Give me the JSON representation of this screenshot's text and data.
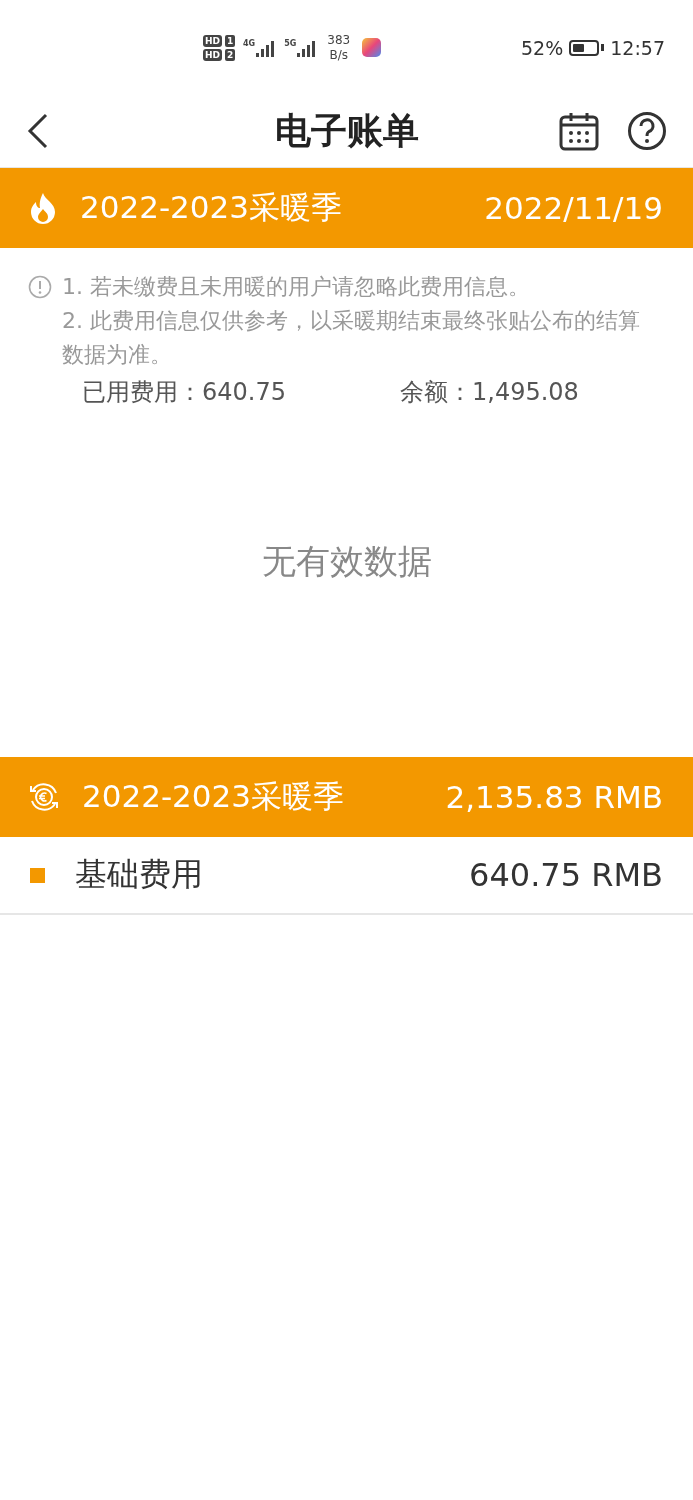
{
  "status_bar": {
    "sims": [
      {
        "hd": "HD",
        "slot": "1",
        "network": "4G"
      },
      {
        "hd": "HD",
        "slot": "2",
        "network": "5G"
      }
    ],
    "speed_value": "383",
    "speed_unit": "B/s",
    "battery": "52%",
    "time": "12:57"
  },
  "header": {
    "title": "电子账单"
  },
  "season_bar": {
    "title": "2022-2023采暖季",
    "date": "2022/11/19"
  },
  "notes": [
    "1. 若未缴费且未用暖的用户请忽略此费用信息。",
    "2. 此费用信息仅供参考，以采暖期结束最终张贴公布的结算数据为准。"
  ],
  "summary": [
    {
      "label": "已用费用：",
      "value": "640.75"
    },
    {
      "label": "余额：",
      "value": "1,495.08"
    }
  ],
  "empty_message": "无有效数据",
  "total_bar": {
    "title": "2022-2023采暖季",
    "amount": "2,135.83 RMB"
  },
  "fees": [
    {
      "name": "基础费用",
      "amount": "640.75 RMB"
    }
  ]
}
